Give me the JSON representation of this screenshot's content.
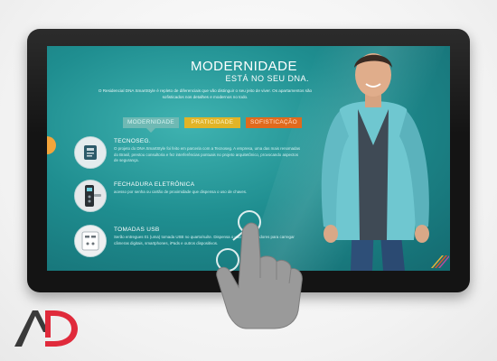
{
  "hero": {
    "title": "MODERNIDADE",
    "subtitle": "ESTÁ NO SEU DNA.",
    "intro": "O Residencial DNA SmartStyle é repleto de diferenciais que vão distinguir o seu jeito de viver. Os apartamentos são sofisticados nos detalhes e modernos no todo."
  },
  "tabs": [
    {
      "label": "MODERNIDADE"
    },
    {
      "label": "PRATICIDADE"
    },
    {
      "label": "SOFISTICAÇÃO"
    }
  ],
  "features": [
    {
      "title": "TECNOSEG.",
      "description": "O projeto do DNA SmartStyle foi feito em parceria com a Tecnoseg. A empresa, uma das mais renomadas do Brasil, prestou consultoria e fez interferências pontuais no projeto arquitetônico, provocando aspectos de segurança.",
      "icon": "security-seal-icon"
    },
    {
      "title": "FECHADURA ELETRÔNICA",
      "description": "acesso por senha ou cartão de proximidade que dispensa o uso de chaves.",
      "icon": "electronic-lock-icon"
    },
    {
      "title": "TOMADAS USB",
      "description": "Serão entregues 01 (uma) tomada USB no quarto/suíte. Dispensa o uso de adaptadores para carregar câmeras digitais, smartphones, iPads e outros dispositivos.",
      "icon": "usb-outlet-icon"
    }
  ],
  "colors": {
    "tab_modernidade": "#6fb9b4",
    "tab_praticidade": "#e1b428",
    "tab_sofisticacao": "#e06a1d",
    "screen_teal": "#1f8e90",
    "logo_red": "#e02a3b"
  }
}
